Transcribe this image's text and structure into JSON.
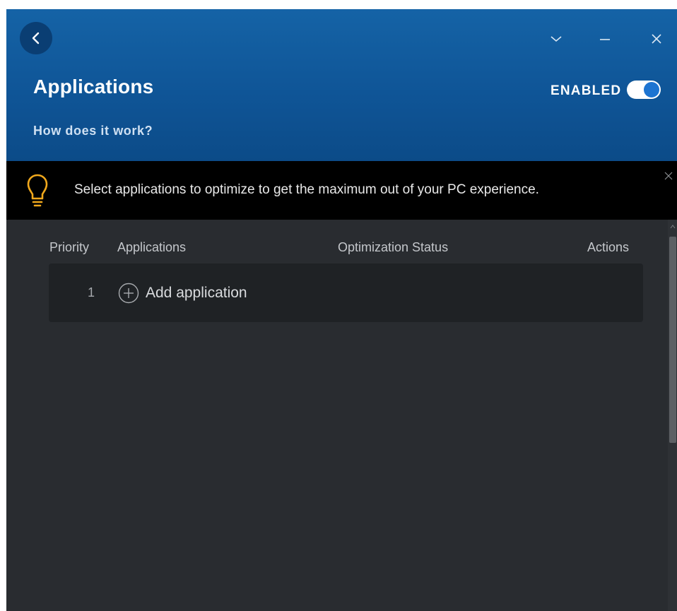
{
  "header": {
    "title": "Applications",
    "help_link": "How does it work?",
    "toggle_label": "ENABLED",
    "toggle_on": true
  },
  "banner": {
    "message": "Select applications to optimize to get the maximum out of your PC experience.",
    "icon": "lightbulb-icon"
  },
  "table": {
    "columns": [
      "Priority",
      "Applications",
      "Optimization Status",
      "Actions"
    ],
    "rows": [
      {
        "priority": "1",
        "action_label": "Add application",
        "icon": "plus-circle-icon"
      }
    ]
  },
  "colors": {
    "header_blue": "#1563a6",
    "accent_toggle": "#1d74d1",
    "bulb_yellow": "#f0a81c",
    "panel_bg": "#292c30",
    "row_bg": "#1f2225"
  }
}
